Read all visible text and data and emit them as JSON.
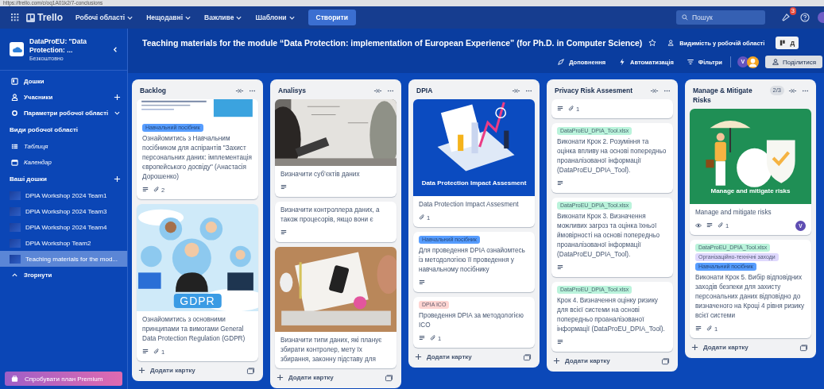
{
  "browser": {
    "url": "https://trello.com/c/oq1A01k2/7-conclusions"
  },
  "topnav": {
    "logo": "Trello",
    "menus": [
      {
        "label": "Робочі області"
      },
      {
        "label": "Нещодавні"
      },
      {
        "label": "Важливе"
      },
      {
        "label": "Шаблони"
      }
    ],
    "create": "Створити",
    "search": {
      "placeholder": "Пошук"
    },
    "notifications": "3"
  },
  "workspace": {
    "name": "DataProEU: \"Data Protection: ...",
    "plan": "Безкоштовно"
  },
  "sidebar": {
    "items": [
      {
        "label": "Дошки",
        "addable": false,
        "expandable": false
      },
      {
        "label": "Учасники",
        "addable": true,
        "expandable": false
      },
      {
        "label": "Параметри робочої області",
        "addable": false,
        "expandable": true
      }
    ],
    "views_title": "Види робочої області",
    "views": [
      {
        "label": "Таблиця"
      },
      {
        "label": "Календар"
      }
    ],
    "boards_title": "Ваші дошки",
    "boards": [
      {
        "label": "DPIA Workshop 2024 Team1",
        "selected": false
      },
      {
        "label": "DPIA Workshop 2024 Team3",
        "selected": false
      },
      {
        "label": "DPIA Workshop 2024 Team4",
        "selected": false
      },
      {
        "label": "DPIA Workshop Team2",
        "selected": false
      },
      {
        "label": "Teaching materials for the mod...",
        "selected": true
      }
    ],
    "collapse": "Згорнути",
    "premium": "Спробувати план Premium"
  },
  "board": {
    "title": "Teaching materials for the module “Data Protection: implementation of European Experience” (for Ph.D. in Computer Science)",
    "visibility": "Видимість у робочій області",
    "view_button": "Д",
    "tools": [
      {
        "label": "Доповнення"
      },
      {
        "label": "Автоматизація"
      },
      {
        "label": "Фільтри"
      }
    ],
    "members": [
      {
        "kind": "letter",
        "initial": "V",
        "color": "#6554c0"
      },
      {
        "kind": "figure",
        "color": "#f5a623"
      }
    ],
    "share": "Поділитися"
  },
  "lists": [
    {
      "title": "Backlog",
      "add_card": "Додати картку",
      "cards": [
        {
          "cover": {
            "kind": "picture"
          },
          "labels": [
            {
              "text": "Навчальний посібник",
              "color": "#579dff"
            }
          ],
          "text": "Ознайомитись з Навчальним посібником для аспірантів \"Захист персональних даних: імплементація європейського досвіду\" (Анастасія Дорошенко)",
          "description": true,
          "attachments": "2"
        },
        {
          "cover": {
            "kind": "picture"
          },
          "caption": "GDPR",
          "text": "Ознайомитись з основними принципами та вимогами General Data Protection Regulation (GDPR)",
          "description": true,
          "attachments": "1"
        }
      ]
    },
    {
      "title": "Analisys",
      "add_card": "Додати картку",
      "cards": [
        {
          "cover": {
            "kind": "picture"
          },
          "text": "Визначити суб’єктів даних",
          "description": true
        },
        {
          "text": "Визначити контроллера даних, а також процесорів, якщо вони є",
          "description": true
        },
        {
          "cover": {
            "kind": "picture"
          },
          "text": "Визначити типи даних, які планує збирати контролер, мету їх збирання, законну підставу для"
        }
      ]
    },
    {
      "title": "DPIA",
      "add_card": "Додати картку",
      "cards": [
        {
          "cover": {
            "kind": "picture"
          },
          "caption": "Data Protection Impact Assesment",
          "text": "Data Protection Impact Assesment",
          "attachments": "1"
        },
        {
          "labels": [
            {
              "text": "Навчальний посібник",
              "color": "#579dff"
            }
          ],
          "text": "Для проведення DPIA ознайомтесь із методологією її проведення у навчальному посібнику",
          "description": true
        },
        {
          "labels": [
            {
              "text": "DPIA ICO",
              "color": "#ffd5d2"
            }
          ],
          "text": "Проведення DPIA за методологією ICO",
          "description": true,
          "attachments": "1"
        }
      ]
    },
    {
      "title": "Privacy Risk Assesment",
      "add_card": "Додати картку",
      "cards": [
        {
          "description": true,
          "attachments": "1"
        },
        {
          "labels": [
            {
              "text": "DataProEU_DPIA_Tool.xlsx",
              "color": "#baf3db"
            }
          ],
          "text": "Виконати Крок 2. Розуміння та оцінка впливу на основі попередньо проаналізованої інформації (DataProEU_DPIA_Tool).",
          "description": true
        },
        {
          "labels": [
            {
              "text": "DataProEU_DPIA_Tool.xlsx",
              "color": "#baf3db"
            }
          ],
          "text": "Виконати Крок 3. Визначення можливих загроз та оцінка їхньої ймовірності на основі попередньо проаналізованої інформації (DataProEU_DPIA_Tool).",
          "description": true
        },
        {
          "labels": [
            {
              "text": "DataProEU_DPIA_Tool.xlsx",
              "color": "#baf3db"
            }
          ],
          "text": "Крок 4. Визначення оцінку ризику для всієї системи на основі попередньо проаналізованої інформації (DataProEU_DPIA_Tool).",
          "description": true
        }
      ]
    },
    {
      "title": "Manage & Mitigate Risks",
      "count": "2/3",
      "add_card": "Додати картку",
      "cards": [
        {
          "cover": {
            "kind": "picture"
          },
          "caption": "Manage and mitigate risks",
          "text": "Manage and mitigate risks",
          "watching": true,
          "description": true,
          "attachments": "1",
          "member": "V"
        },
        {
          "labels": [
            {
              "text": "DataProEU_DPIA_Tool.xlsx",
              "color": "#baf3db"
            },
            {
              "text": "Організаційно-технічні заходи",
              "color": "#dfd8fd"
            },
            {
              "text": "Навчальний посібник",
              "color": "#579dff"
            }
          ],
          "text": "Виконати Крок 5. Вибір відповідних заходів безпеки для захисту персональних даних відповідно до визначеного на Кроці 4 рівня ризику всієї системи",
          "description": true,
          "attachments": "1"
        }
      ]
    }
  ]
}
